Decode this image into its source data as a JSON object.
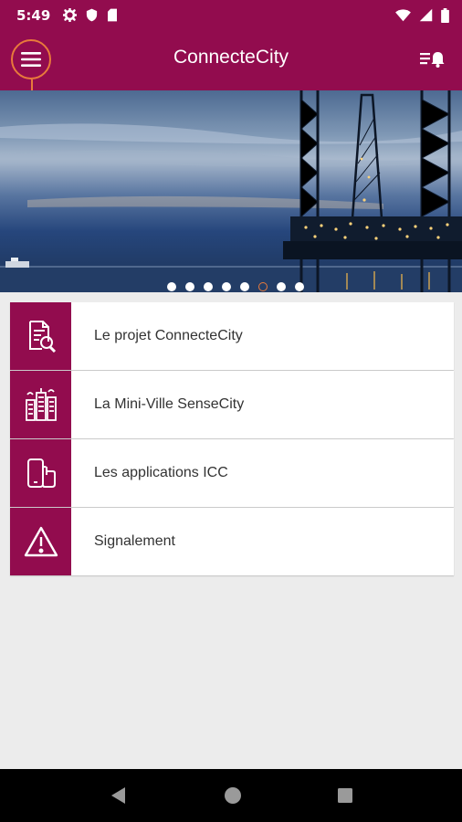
{
  "status_bar": {
    "time": "5:49",
    "icons_left": [
      "gear-icon",
      "shield-icon",
      "sd-card-icon"
    ],
    "icons_right": [
      "wifi-icon",
      "signal-icon",
      "battery-icon"
    ]
  },
  "app_bar": {
    "title": "ConnecteCity",
    "menu_icon": "hamburger-menu-icon",
    "notifications_icon": "notification-list-icon"
  },
  "banner": {
    "image": "offshore-oil-rig-at-dusk",
    "carousel_dots": 8,
    "active_dot": 6
  },
  "menu": {
    "items": [
      {
        "label": "Le projet ConnecteCity",
        "icon": "document-search-icon"
      },
      {
        "label": "La Mini-Ville SenseCity",
        "icon": "city-buildings-icon"
      },
      {
        "label": "Les applications ICC",
        "icon": "phone-hand-icon"
      },
      {
        "label": "Signalement",
        "icon": "warning-triangle-icon"
      }
    ]
  },
  "nav_bar": {
    "buttons": [
      "back-icon",
      "home-icon",
      "recents-icon"
    ]
  },
  "colors": {
    "primary": "#920c4e",
    "accent": "#e87a3b",
    "background": "#ececec"
  }
}
